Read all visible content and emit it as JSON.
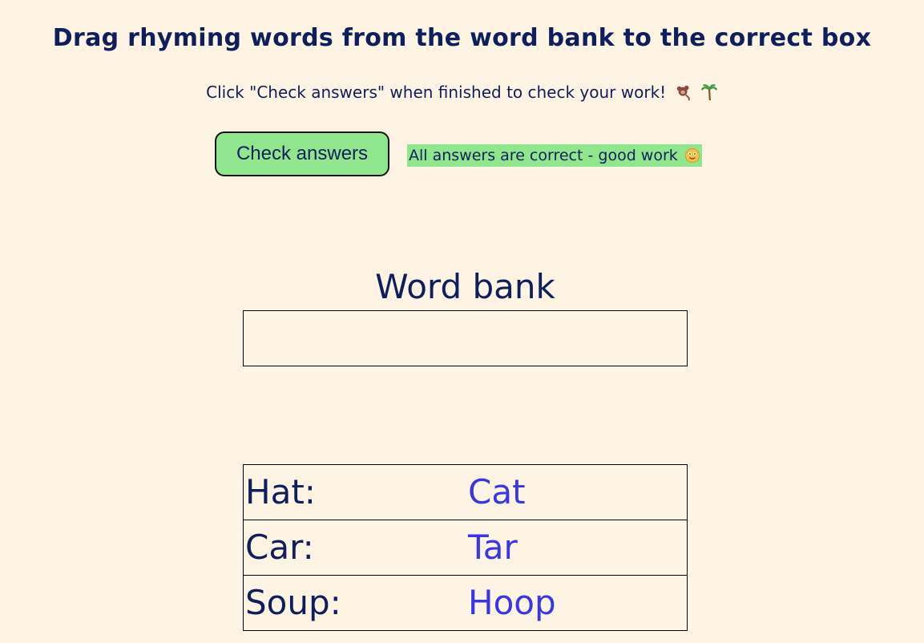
{
  "header": {
    "title": "Drag rhyming words from the word bank to the correct box",
    "subtitle": "Click \"Check answers\" when finished to check your work!",
    "emoji_icons": [
      "monkey-icon",
      "palm-tree-icon"
    ]
  },
  "controls": {
    "check_button_label": "Check answers",
    "feedback_text": "All answers are correct - good work",
    "feedback_icon": "smiley-icon",
    "feedback_color": "#8fe68c"
  },
  "word_bank": {
    "heading": "Word bank",
    "items": []
  },
  "rows": [
    {
      "prompt": "Hat:",
      "answer": "Cat"
    },
    {
      "prompt": "Car:",
      "answer": "Tar"
    },
    {
      "prompt": "Soup:",
      "answer": "Hoop"
    }
  ],
  "colors": {
    "background": "#fdf4e3",
    "text": "#0f1f5c",
    "answer_text": "#3a35e6"
  }
}
